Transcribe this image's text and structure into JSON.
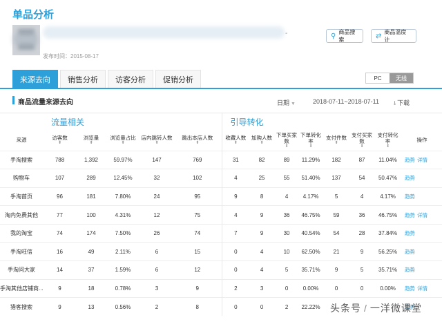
{
  "page": {
    "title": "单品分析"
  },
  "product": {
    "publish_date": "发布时间：2015-08-17",
    "name_suffix": "-"
  },
  "toolbar": {
    "search_label": "商品搜索",
    "monitor_label": "商品温度计"
  },
  "tabs": [
    {
      "label": "来源去向",
      "active": true
    },
    {
      "label": "销售分析",
      "active": false
    },
    {
      "label": "访客分析",
      "active": false
    },
    {
      "label": "促销分析",
      "active": false
    }
  ],
  "device_toggle": {
    "pc": "PC",
    "wireless": "无线"
  },
  "section": {
    "title": "商品流量来源去向",
    "date_label": "日期",
    "date_range": "2018-07-11~2018-07-11",
    "download": "下载"
  },
  "table": {
    "group_traffic": "流量相关",
    "group_conversion": "引导转化",
    "source_header": "来源",
    "columns": [
      {
        "l1": "访客数",
        "l2": ""
      },
      {
        "l1": "浏览量",
        "l2": ""
      },
      {
        "l1": "浏览量占比",
        "l2": ""
      },
      {
        "l1": "店内跳转人数",
        "l2": ""
      },
      {
        "l1": "跳出本店人数",
        "l2": ""
      },
      {
        "l1": "收藏人数",
        "l2": ""
      },
      {
        "l1": "加购人数",
        "l2": ""
      },
      {
        "l1": "下单买家",
        "l2": "数"
      },
      {
        "l1": "下单转化",
        "l2": "率"
      },
      {
        "l1": "支付件数",
        "l2": ""
      },
      {
        "l1": "支付买家",
        "l2": "数"
      },
      {
        "l1": "支付转化",
        "l2": "率"
      }
    ],
    "ops_header": "操作",
    "op_trend": "趋势",
    "op_detail": "详情",
    "rows": [
      {
        "source": "手淘搜索",
        "v": [
          "788",
          "1,392",
          "59.97%",
          "147",
          "769",
          "31",
          "82",
          "89",
          "11.29%",
          "182",
          "87",
          "11.04%"
        ],
        "detail": true
      },
      {
        "source": "购物车",
        "v": [
          "107",
          "289",
          "12.45%",
          "32",
          "102",
          "4",
          "25",
          "55",
          "51.40%",
          "137",
          "54",
          "50.47%"
        ],
        "detail": false
      },
      {
        "source": "手淘首页",
        "v": [
          "96",
          "181",
          "7.80%",
          "24",
          "95",
          "9",
          "8",
          "4",
          "4.17%",
          "5",
          "4",
          "4.17%"
        ],
        "detail": false
      },
      {
        "source": "淘内免费其他",
        "v": [
          "77",
          "100",
          "4.31%",
          "12",
          "75",
          "4",
          "9",
          "36",
          "46.75%",
          "59",
          "36",
          "46.75%"
        ],
        "detail": true
      },
      {
        "source": "我的淘宝",
        "v": [
          "74",
          "174",
          "7.50%",
          "26",
          "74",
          "7",
          "9",
          "30",
          "40.54%",
          "54",
          "28",
          "37.84%"
        ],
        "detail": false
      },
      {
        "source": "手淘旺信",
        "v": [
          "16",
          "49",
          "2.11%",
          "6",
          "15",
          "0",
          "4",
          "10",
          "62.50%",
          "21",
          "9",
          "56.25%"
        ],
        "detail": false
      },
      {
        "source": "手淘问大家",
        "v": [
          "14",
          "37",
          "1.59%",
          "6",
          "12",
          "0",
          "4",
          "5",
          "35.71%",
          "9",
          "5",
          "35.71%"
        ],
        "detail": false
      },
      {
        "source": "手淘其他店铺商...",
        "v": [
          "9",
          "18",
          "0.78%",
          "3",
          "9",
          "2",
          "3",
          "0",
          "0.00%",
          "0",
          "0",
          "0.00%"
        ],
        "detail": true
      },
      {
        "source": "猎客搜索",
        "v": [
          "9",
          "13",
          "0.56%",
          "2",
          "8",
          "0",
          "0",
          "2",
          "22.22%",
          "",
          "",
          ""
        ],
        "detail": false
      }
    ]
  },
  "watermark": {
    "left": "头条号",
    "sep": "/",
    "right": "一洋微课堂"
  }
}
